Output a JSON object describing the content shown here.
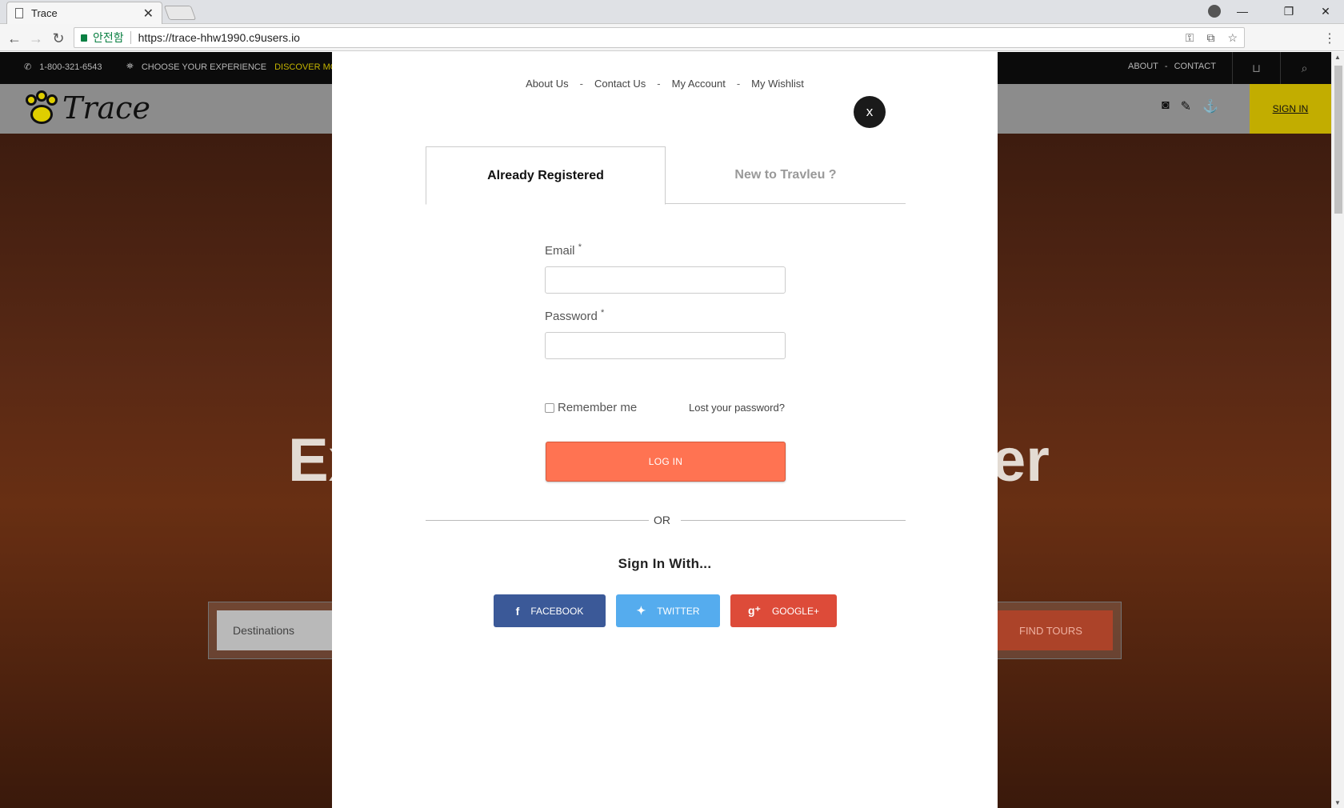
{
  "browser": {
    "tab_title": "Trace",
    "tab_close": "✕",
    "secure_label": "안전함",
    "url": "https://trace-hhw1990.c9users.io",
    "window_controls": [
      "—",
      "❐",
      "✕"
    ]
  },
  "site": {
    "phone": "1-800-321-6543",
    "choose_text": "CHOOSE YOUR EXPERIENCE",
    "discover_text": "DISCOVER MOR",
    "top_links": [
      "ABOUT",
      "-",
      "CONTACT"
    ],
    "logo_text": "Trace",
    "signin_label": "SIGN IN",
    "hero_left": "Ex",
    "hero_right": "er",
    "destinations_placeholder": "Destinations",
    "find_tours_label": "FIND TOURS",
    "accent_color": "#c6b100"
  },
  "modal": {
    "nav": [
      "About Us",
      "Contact Us",
      "My Account",
      "My Wishlist"
    ],
    "nav_separator": "-",
    "close_label": "x",
    "tabs": [
      "Already Registered",
      "New to Travleu ?"
    ],
    "email_label": "Email",
    "password_label": "Password",
    "required_mark": "*",
    "remember_label": "Remember me",
    "lost_password": "Lost your password?",
    "login_label": "LOG IN",
    "login_color": "#ff7352",
    "or_text": "OR",
    "sign_in_with": "Sign In With...",
    "social": [
      {
        "label": "FACEBOOK",
        "icon": "facebook-icon",
        "color": "#3b5998"
      },
      {
        "label": "TWITTER",
        "icon": "twitter-icon",
        "color": "#55acee"
      },
      {
        "label": "GOOGLE+",
        "icon": "google-plus-icon",
        "color": "#dd4b39"
      }
    ]
  }
}
